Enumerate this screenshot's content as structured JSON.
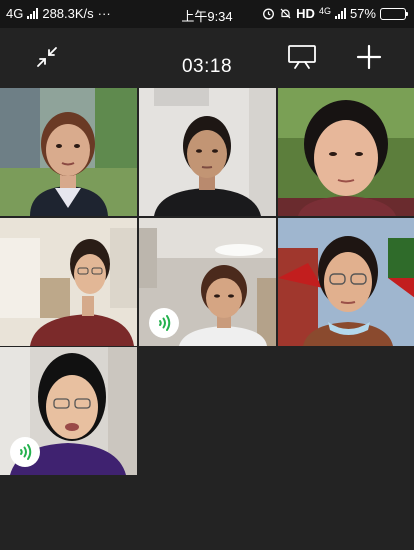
{
  "status_bar": {
    "network": "4G",
    "speed": "288.3K/s",
    "dots": "···",
    "time": "上午9:34",
    "hd": "HD",
    "network_right": "4G",
    "battery": "57%",
    "battery_level": 0.57
  },
  "meeting": {
    "duration": "03:18"
  },
  "participants": [
    {
      "position": 1,
      "speaking": false
    },
    {
      "position": 2,
      "speaking": false
    },
    {
      "position": 3,
      "speaking": false
    },
    {
      "position": 4,
      "speaking": false
    },
    {
      "position": 5,
      "speaking": true
    },
    {
      "position": 6,
      "speaking": false
    },
    {
      "position": 7,
      "speaking": true
    }
  ],
  "icons": {
    "minimize": "collapse-arrows-icon",
    "share_screen": "projector-screen-icon",
    "add": "plus-icon",
    "speaking": "speaking-wave-icon",
    "alarm": "alarm-clock-icon",
    "mute": "bell-off-icon"
  },
  "colors": {
    "background": "#232323",
    "status_bar": "#161616",
    "speaking_indicator": "#22b14c"
  }
}
